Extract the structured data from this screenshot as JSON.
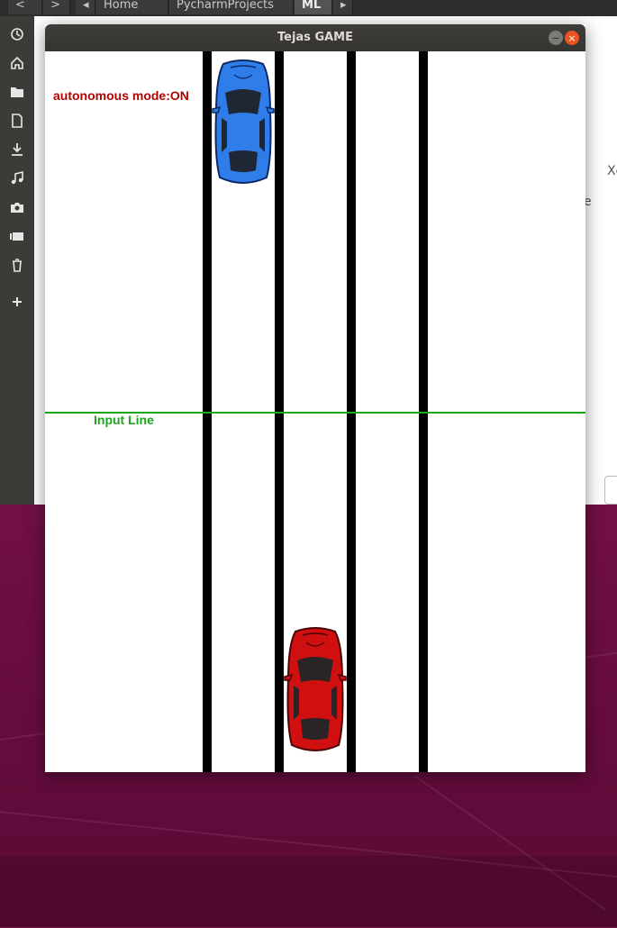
{
  "file_manager": {
    "path_tabs": [
      "<",
      ">",
      "◂",
      "Home",
      "PycharmProjects",
      "ML",
      "▸"
    ],
    "content_fragments": [
      "Xc",
      "e"
    ],
    "sidebar_icons": [
      "recent-icon",
      "home-icon",
      "folder-icon",
      "document-icon",
      "download-icon",
      "music-icon",
      "camera-icon",
      "video-icon",
      "trash-icon",
      "add-icon"
    ]
  },
  "window": {
    "title": "Tejas GAME",
    "minimize_label": "−",
    "close_label": "×"
  },
  "game": {
    "autonomous_label": "autonomous mode:ON",
    "input_line_label": "Input Line",
    "colors": {
      "autonomous_text": "#b30000",
      "input_line": "#1aa51a",
      "lane_divider": "#000000",
      "player_car": "#d01010",
      "enemy_car": "#2f7de8"
    }
  }
}
